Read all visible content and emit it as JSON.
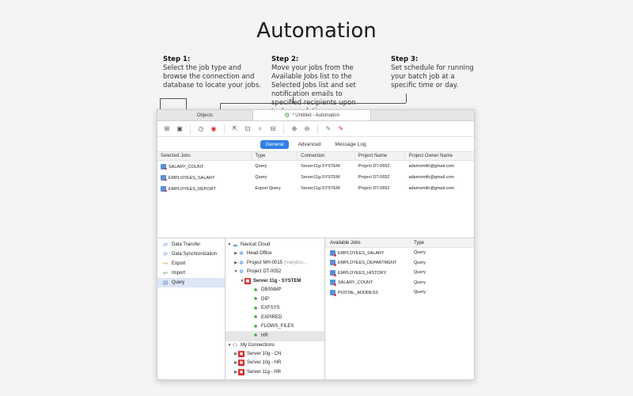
{
  "page": {
    "title": "Automation"
  },
  "steps": [
    {
      "heading": "Step 1:",
      "text": "Select the job type and browse the connection and database to locate your jobs."
    },
    {
      "heading": "Step 2:",
      "text": "Move your jobs from the Available Jobs list to the Selected Jobs list and set notification emails to specified recipients upon task completion."
    },
    {
      "heading": "Step 3:",
      "text": "Set schedule for running your batch job at a specific time or day."
    }
  ],
  "window": {
    "tabs": {
      "objects": "Objects",
      "active": "* Untitled - Automation"
    },
    "subtabs": [
      "General",
      "Advanced",
      "Message Log"
    ],
    "jobs_columns": [
      "Selected Jobs",
      "Type",
      "Connection",
      "Project Name",
      "Project Owner Name"
    ],
    "jobs": [
      {
        "name": "SALARY_COUNT",
        "type": "Query",
        "connection": "Server11g-SYSTEM",
        "project": "Project DT-0652",
        "owner": "adamsmith@gmail.com"
      },
      {
        "name": "EMPLOYEES_SALARY",
        "type": "Query",
        "connection": "Server11g-SYSTEM",
        "project": "Project DT-0652",
        "owner": "adamsmith@gmail.com"
      },
      {
        "name": "EMPLOYEES_REPORT",
        "type": "Export Query",
        "connection": "Server11g-SYSTEM",
        "project": "Project DT-0652",
        "owner": "adamsmith@gmail.com"
      }
    ],
    "job_types": [
      "Data Transfer",
      "Data Synchronization",
      "Export",
      "Import",
      "Query"
    ],
    "tree": {
      "cloud": "Navicat Cloud",
      "head_office": "Head Office",
      "project_mh": "Project MH-0015",
      "project_mh_owner": "(marybro...",
      "project_dt": "Project DT-0052",
      "server": "Server 11g - SYSTEM",
      "schemas": [
        "DBSNMP",
        "DIP",
        "EXFSYS",
        "EXPIRED",
        "FLOWS_FILES",
        "HR"
      ],
      "my_connections": "My Connections",
      "connections": [
        "Server 10g - CN",
        "Server 10g - HR",
        "Server 11g - HR"
      ]
    },
    "available_columns": [
      "Available Jobs",
      "Type"
    ],
    "available": [
      {
        "name": "EMPLOYEES_SALARY",
        "type": "Query"
      },
      {
        "name": "EMPLOYEES_DEPARTMENT",
        "type": "Query"
      },
      {
        "name": "EMPLOYEES_HISTORY",
        "type": "Query"
      },
      {
        "name": "SALARY_COUNT",
        "type": "Query"
      },
      {
        "name": "POSTAL_ADDRESS",
        "type": "Query"
      }
    ]
  },
  "colors": {
    "accent": "#2f7fe6",
    "server_red": "#d82b2b",
    "schema_green": "#3aa33a"
  }
}
